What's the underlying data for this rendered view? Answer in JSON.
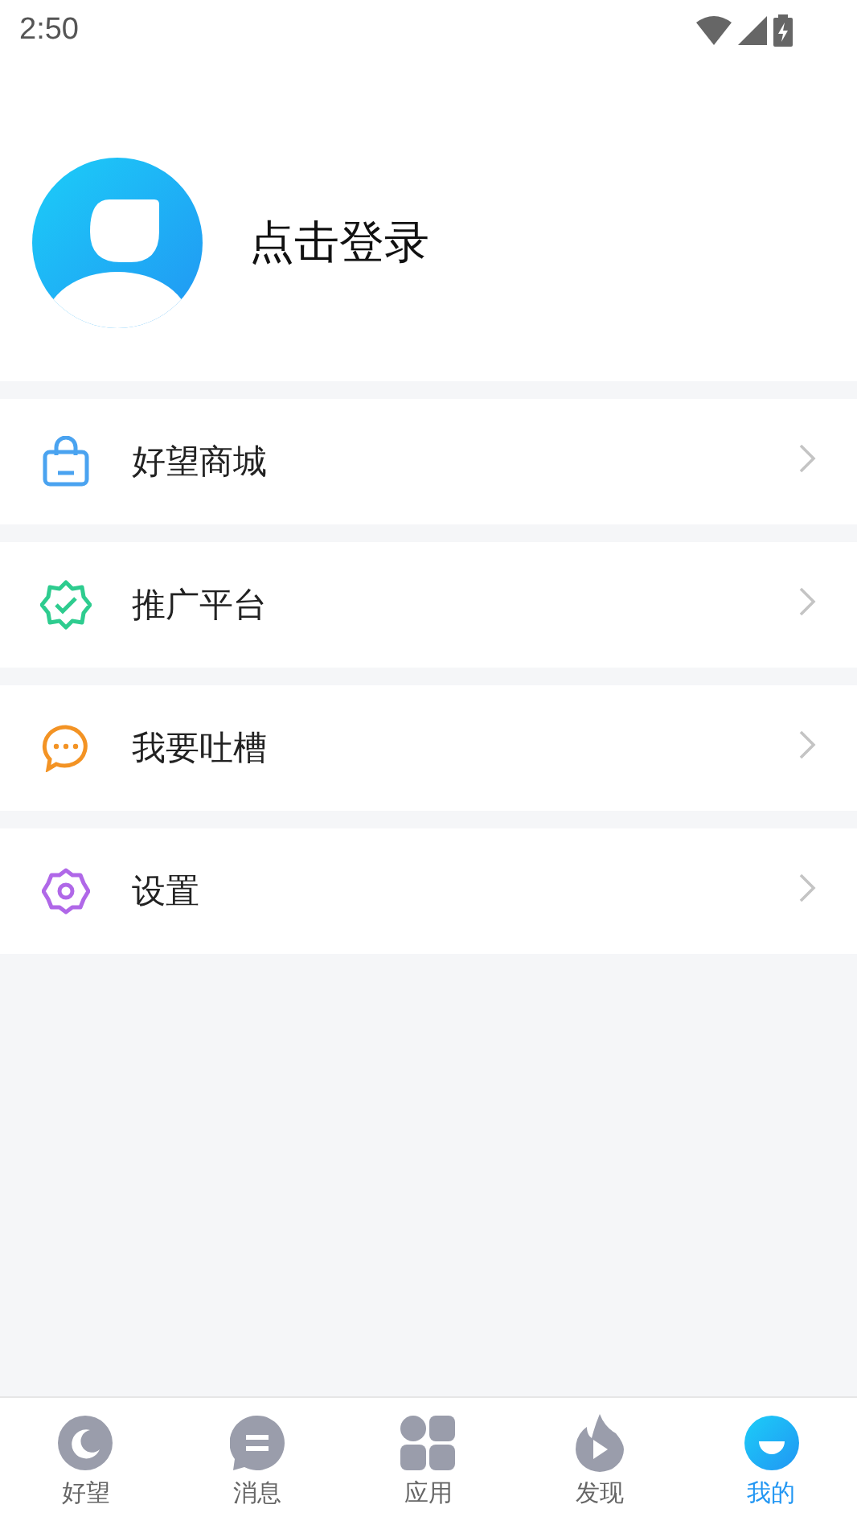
{
  "status_bar": {
    "time": "2:50"
  },
  "profile": {
    "login_label": "点击登录"
  },
  "menu": [
    {
      "kind": "bag",
      "label": "好望商城"
    },
    {
      "kind": "badge",
      "label": "推广平台"
    },
    {
      "kind": "chat",
      "label": "我要吐槽"
    },
    {
      "kind": "gear",
      "label": "设置"
    }
  ],
  "tab_bar": [
    {
      "kind": "home",
      "label": "好望",
      "selected": false
    },
    {
      "kind": "message",
      "label": "消息",
      "selected": false
    },
    {
      "kind": "apps",
      "label": "应用",
      "selected": false
    },
    {
      "kind": "discover",
      "label": "发现",
      "selected": false
    },
    {
      "kind": "me",
      "label": "我的",
      "selected": true
    }
  ]
}
